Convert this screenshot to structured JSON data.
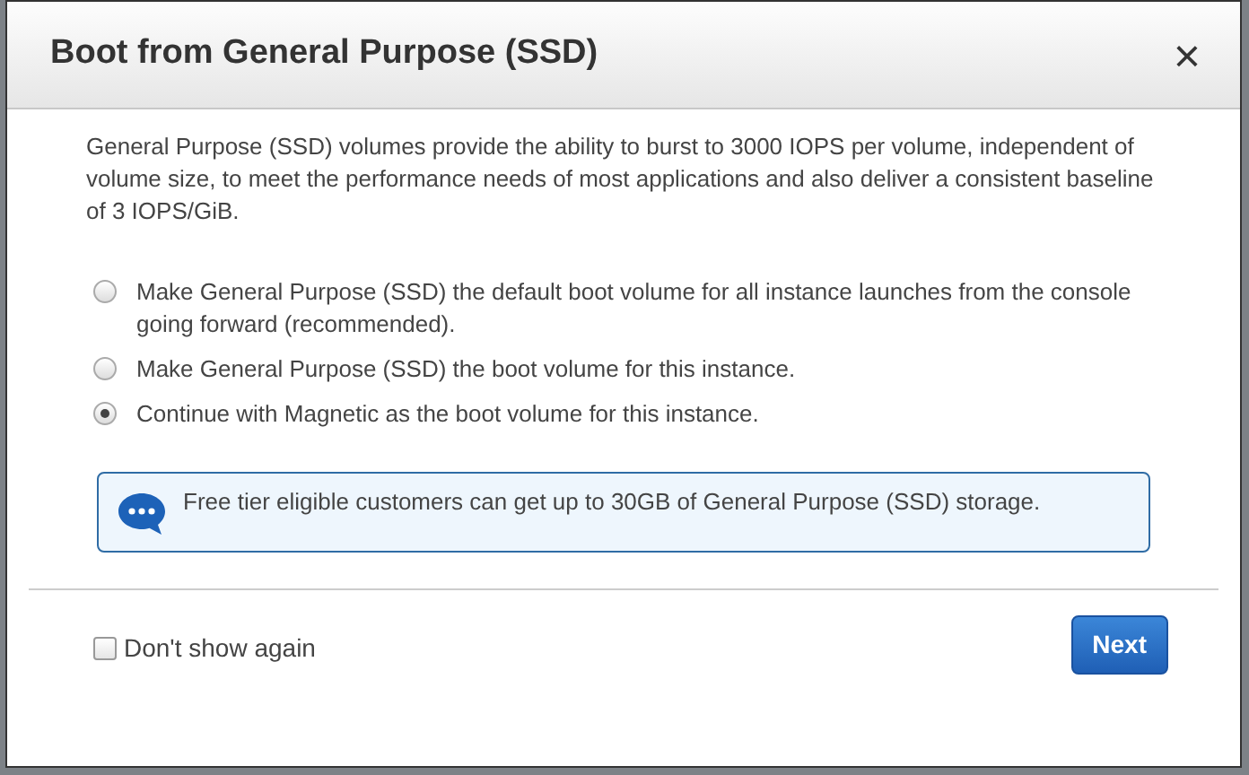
{
  "dialog": {
    "title": "Boot from General Purpose (SSD)",
    "close": "×",
    "description": "General Purpose (SSD) volumes provide the ability to burst to 3000 IOPS per volume, independent of volume size, to meet the performance needs of most applications and also deliver a consistent baseline of 3 IOPS/GiB.",
    "options": [
      {
        "label": "Make General Purpose (SSD) the default boot volume for all instance launches from the console going forward (recommended).",
        "selected": false
      },
      {
        "label": "Make General Purpose (SSD) the boot volume for this instance.",
        "selected": false
      },
      {
        "label": "Continue with Magnetic as the boot volume for this instance.",
        "selected": true
      }
    ],
    "info": "Free tier eligible customers can get up to 30GB of General Purpose (SSD) storage.",
    "dont_show_again": {
      "label": "Don't show again",
      "checked": false
    },
    "next_button": "Next"
  }
}
